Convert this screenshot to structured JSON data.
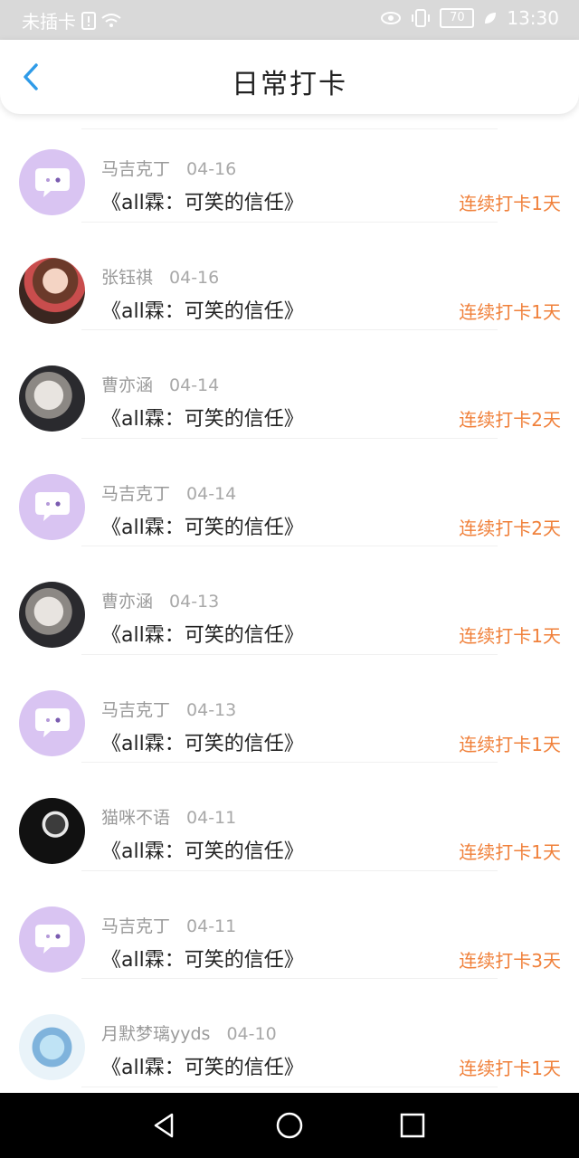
{
  "status_bar": {
    "carrier": "未插卡",
    "battery": "70",
    "time": "13:30",
    "icons": [
      "sim-alert-icon",
      "wifi-icon",
      "eye-icon",
      "vibrate-icon",
      "battery-icon",
      "leaf-icon"
    ]
  },
  "header": {
    "title": "日常打卡",
    "back_icon": "chevron-left-icon"
  },
  "colors": {
    "accent": "#f0803a",
    "back_arrow": "#2f9be8",
    "default_avatar": "#d9c4f2"
  },
  "items": [
    {
      "name": "马吉克丁",
      "date": "04-16",
      "book": "《all霖：可笑的信任》",
      "streak": "连续打卡1天",
      "avatar": "default"
    },
    {
      "name": "张钰祺",
      "date": "04-16",
      "book": "《all霖：可笑的信任》",
      "streak": "连续打卡1天",
      "avatar": "photo1"
    },
    {
      "name": "曹亦涵",
      "date": "04-14",
      "book": "《all霖：可笑的信任》",
      "streak": "连续打卡2天",
      "avatar": "photo2"
    },
    {
      "name": "马吉克丁",
      "date": "04-14",
      "book": "《all霖：可笑的信任》",
      "streak": "连续打卡2天",
      "avatar": "default"
    },
    {
      "name": "曹亦涵",
      "date": "04-13",
      "book": "《all霖：可笑的信任》",
      "streak": "连续打卡1天",
      "avatar": "photo2"
    },
    {
      "name": "马吉克丁",
      "date": "04-13",
      "book": "《all霖：可笑的信任》",
      "streak": "连续打卡1天",
      "avatar": "default"
    },
    {
      "name": "猫咪不语",
      "date": "04-11",
      "book": "《all霖：可笑的信任》",
      "streak": "连续打卡1天",
      "avatar": "photo3"
    },
    {
      "name": "马吉克丁",
      "date": "04-11",
      "book": "《all霖：可笑的信任》",
      "streak": "连续打卡3天",
      "avatar": "default"
    },
    {
      "name": "月默梦璃yyds",
      "date": "04-10",
      "book": "《all霖：可笑的信任》",
      "streak": "连续打卡1天",
      "avatar": "photo4"
    }
  ],
  "nav_bar": {
    "icons": [
      "back-triangle-icon",
      "home-circle-icon",
      "recents-square-icon"
    ]
  }
}
